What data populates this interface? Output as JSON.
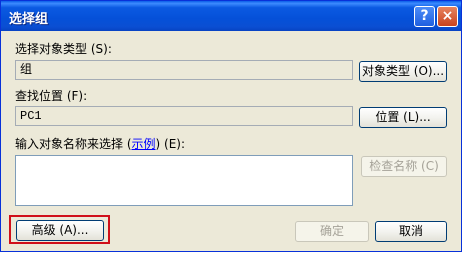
{
  "window": {
    "title": "选择组",
    "help_glyph": "?",
    "close_glyph": "×"
  },
  "object_type": {
    "label": "选择对象类型",
    "key": "(S):",
    "key_letter": "S",
    "value": "组",
    "button_label": "对象类型 (O)..."
  },
  "location": {
    "label": "查找位置",
    "key": "(F):",
    "value": "PC1",
    "button_label": "位置 (L)..."
  },
  "names": {
    "label_prefix": "输入对象名称来选择 (",
    "link_text": "示例",
    "label_suffix": ") (E):",
    "value": "",
    "check_button_label": "检查名称 (C)"
  },
  "footer": {
    "advanced_label": "高级 (A)...",
    "ok_label": "确定",
    "cancel_label": "取消"
  },
  "colors": {
    "highlight": "#d0101a",
    "title_bar": "#0550d8",
    "dialog_bg": "#ece9d8"
  }
}
